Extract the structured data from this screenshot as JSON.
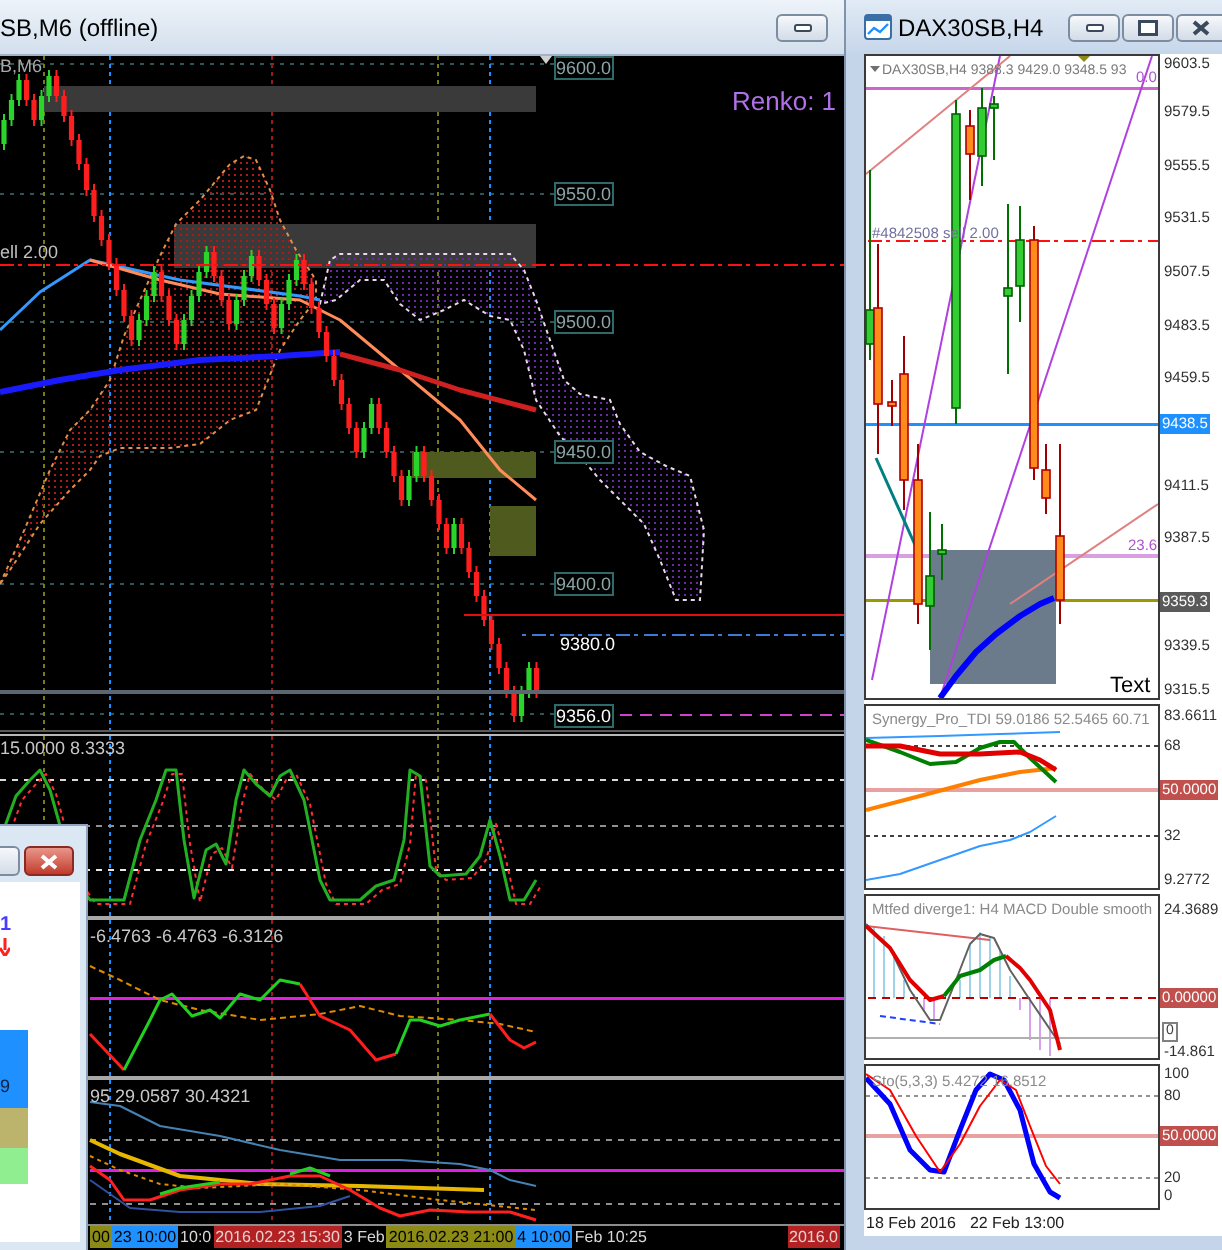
{
  "left_window": {
    "title": "SB,M6 (offline)",
    "chart": {
      "symbol": "B,M6",
      "renko_label": "Renko: 1",
      "order_label": "ell 2.00",
      "price_labels": [
        {
          "text": "9600.0",
          "kind": "axis"
        },
        {
          "text": "9550.0",
          "kind": "axis"
        },
        {
          "text": "9500.0",
          "kind": "axis"
        },
        {
          "text": "9450.0",
          "kind": "axis"
        },
        {
          "text": "9400.0",
          "kind": "axis"
        },
        {
          "text": "9380.0",
          "kind": "line"
        },
        {
          "text": "9356.0",
          "kind": "current"
        }
      ],
      "indicator_panes": [
        {
          "label": "15.0000 8.3333"
        },
        {
          "label": "-6.4763 -6.4763 -6.3126"
        },
        {
          "label": "95 29.0587 30.4321"
        }
      ],
      "time_labels": [
        {
          "text": "00",
          "color": "#8b8b16"
        },
        {
          "text": "23 10:00",
          "color": "#1e90ff"
        },
        {
          "text": "10:0"
        },
        {
          "text": "2016.02.23 15:30",
          "color": "#b22222"
        },
        {
          "text": "3 Feb"
        },
        {
          "text": "2016.02.23 21:00",
          "color": "#8b8b16"
        },
        {
          "text": "4 10:00",
          "color": "#1e90ff"
        },
        {
          "text": "Feb 10:25"
        },
        {
          "text": "2016.0",
          "color": "#b22222"
        }
      ]
    }
  },
  "dialog": {
    "marker": "1",
    "value": "9"
  },
  "right_window": {
    "title": "DAX30SB,H4",
    "chart": {
      "header": "DAX30SB,H4 9388.3 9429.0 9348.5 93",
      "order_label": "#4842508 sell 2.00",
      "fib_labels": [
        "0.0",
        "23.6"
      ],
      "text_object": "Text",
      "price_labels": [
        {
          "text": "9603.5",
          "kind": "axis"
        },
        {
          "text": "9579.5",
          "kind": "axis"
        },
        {
          "text": "9555.5",
          "kind": "axis"
        },
        {
          "text": "9531.5",
          "kind": "axis"
        },
        {
          "text": "9507.5",
          "kind": "axis"
        },
        {
          "text": "9483.5",
          "kind": "axis"
        },
        {
          "text": "9459.5",
          "kind": "axis"
        },
        {
          "text": "9438.5",
          "kind": "highlight",
          "color": "#1e90ff"
        },
        {
          "text": "9411.5",
          "kind": "axis"
        },
        {
          "text": "9387.5",
          "kind": "axis"
        },
        {
          "text": "9359.3",
          "kind": "highlight",
          "color": "#5a5a5a"
        },
        {
          "text": "9339.5",
          "kind": "axis"
        },
        {
          "text": "9315.5",
          "kind": "axis"
        }
      ],
      "indicator_panes": [
        {
          "label": "Synergy_Pro_TDI 59.0186 52.5465 60.71",
          "scale": [
            {
              "text": "83.6611",
              "kind": "axis"
            },
            {
              "text": "68",
              "kind": "axis"
            },
            {
              "text": "50.0000",
              "kind": "highlight",
              "color": "#c0504d"
            },
            {
              "text": "32",
              "kind": "axis"
            },
            {
              "text": "9.2772",
              "kind": "axis"
            }
          ]
        },
        {
          "label": "Mtfed diverge1: H4 MACD Double smooth",
          "scale": [
            {
              "text": "24.3689",
              "kind": "axis"
            },
            {
              "text": "0.00000",
              "kind": "highlight",
              "color": "#c0504d"
            },
            {
              "text": "0",
              "kind": "marker"
            },
            {
              "text": "-14.861",
              "kind": "axis"
            }
          ]
        },
        {
          "label": "Sto(5,3,3) 5.4272 16.8512",
          "scale": [
            {
              "text": "100",
              "kind": "axis"
            },
            {
              "text": "80",
              "kind": "axis"
            },
            {
              "text": "50.0000",
              "kind": "highlight",
              "color": "#c0504d"
            },
            {
              "text": "20",
              "kind": "axis"
            },
            {
              "text": "0",
              "kind": "axis"
            }
          ]
        }
      ],
      "time_labels": [
        "18 Feb 2016",
        "22 Feb 13:00"
      ]
    }
  }
}
